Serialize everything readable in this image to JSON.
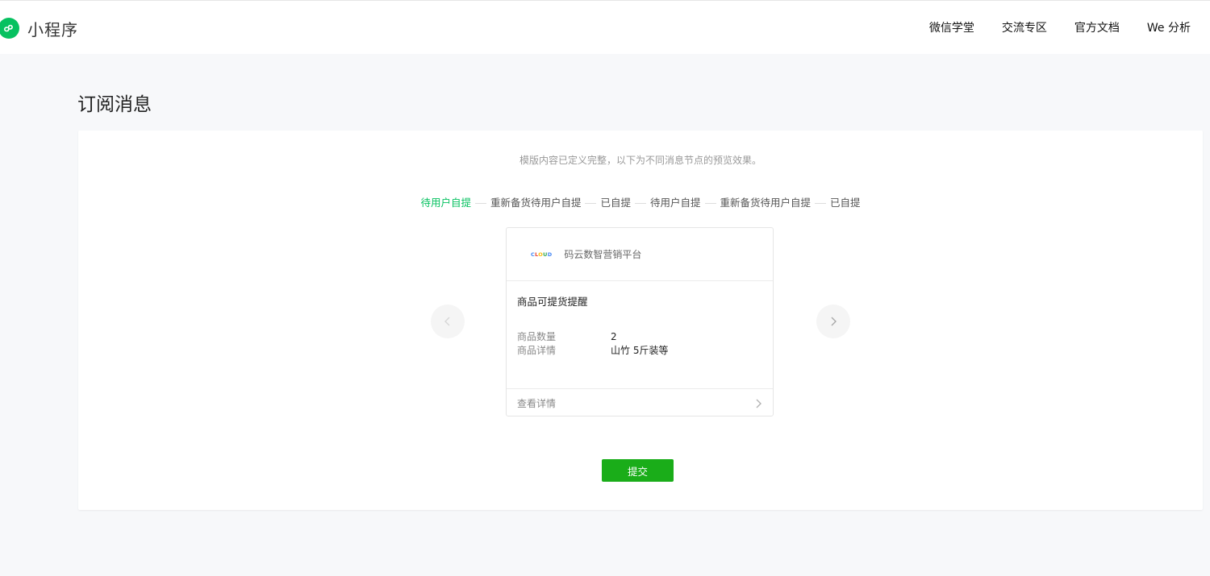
{
  "header": {
    "brand": "小程序",
    "nav": [
      "微信学堂",
      "交流专区",
      "官方文档",
      "We 分析"
    ]
  },
  "page": {
    "title": "订阅消息",
    "hint": "模版内容已定义完整，以下为不同消息节点的预览效果。"
  },
  "steps": [
    {
      "label": "待用户自提",
      "active": true
    },
    {
      "label": "重新备货待用户自提",
      "active": false
    },
    {
      "label": "已自提",
      "active": false
    },
    {
      "label": "待用户自提",
      "active": false
    },
    {
      "label": "重新备货待用户自提",
      "active": false
    },
    {
      "label": "已自提",
      "active": false
    }
  ],
  "card": {
    "logo_text": "CLOUD",
    "app_name": "码云数智营销平台",
    "title": "商品可提货提醒",
    "fields": [
      {
        "label": "商品数量",
        "value": "2"
      },
      {
        "label": "商品详情",
        "value": "山竹 5斤装等"
      }
    ],
    "footer": "查看详情"
  },
  "actions": {
    "submit": "提交"
  },
  "colors": {
    "accent": "#07c160",
    "button": "#1aad19"
  }
}
